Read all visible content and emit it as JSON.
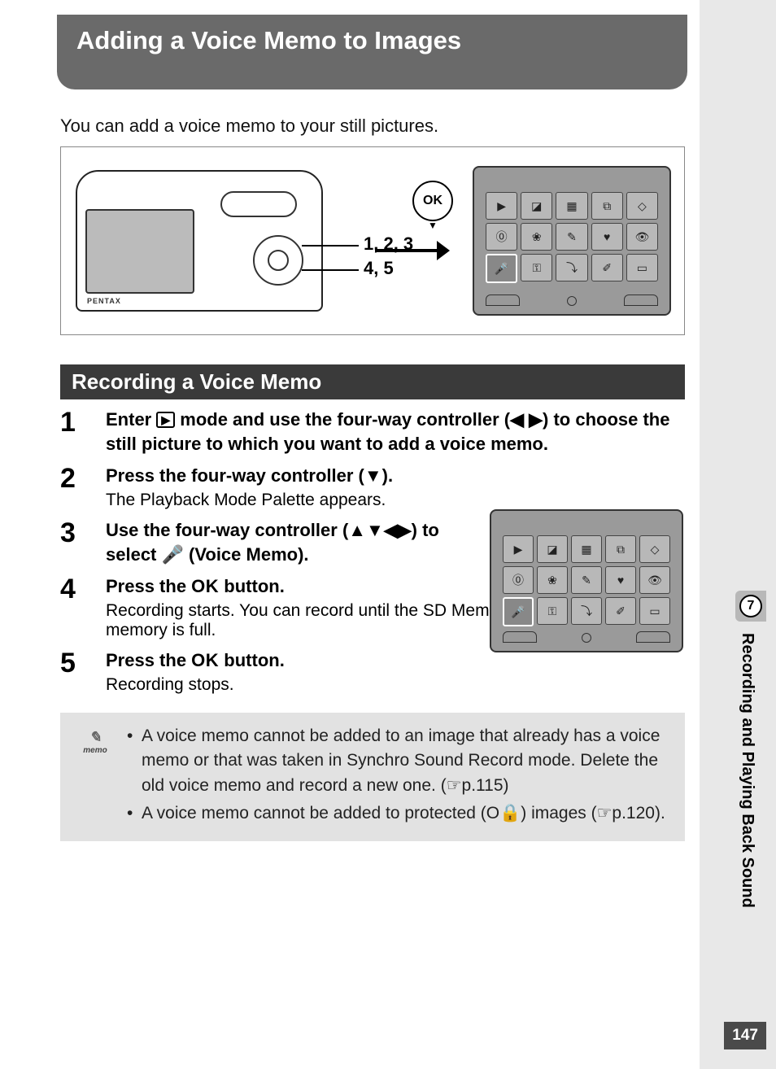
{
  "title": "Adding a Voice Memo to Images",
  "intro": "You can add a voice memo to your still pictures.",
  "diagram": {
    "camera_brand": "PENTAX",
    "leader1": "1, 2, 3",
    "leader2": "4, 5",
    "ok_label": "OK"
  },
  "section_header": "Recording a Voice Memo",
  "steps": [
    {
      "num": "1",
      "title_pre": "Enter ",
      "title_icon": "▶",
      "title_mid": " mode and use the four-way controller (◀ ▶) to choose the still picture to which you want to add a voice memo.",
      "desc": ""
    },
    {
      "num": "2",
      "title": "Press the four-way controller (▼).",
      "desc": "The Playback Mode Palette appears."
    },
    {
      "num": "3",
      "title_pre": "Use the four-way controller (▲▼◀▶) to select ",
      "title_icon": "🎤",
      "title_post": " (Voice Memo).",
      "desc": ""
    },
    {
      "num": "4",
      "title_pre": "Press the ",
      "title_ok": "OK",
      "title_post": " button.",
      "desc": "Recording starts. You can record until the SD Memory Card or built-in memory is full."
    },
    {
      "num": "5",
      "title_pre": "Press the ",
      "title_ok": "OK",
      "title_post": " button.",
      "desc": "Recording stops."
    }
  ],
  "memo": {
    "label": "memo",
    "bullets": [
      "A voice memo cannot be added to an image that already has a voice memo or that was taken in Synchro Sound Record mode. Delete the old voice memo and record a new one. (☞p.115)",
      "A voice memo cannot be added to protected (O🔒) images (☞p.120)."
    ]
  },
  "rail": {
    "chapter_num": "7",
    "chapter_title": "Recording and Playing Back Sound",
    "page_num": "147"
  },
  "palette_cells": [
    "▶",
    "◪",
    "▦",
    "⧉",
    "◇",
    "⓪",
    "❀",
    "✎",
    "♥",
    "👁",
    "🎤",
    "⚿",
    "⤵",
    "✐",
    "▭"
  ],
  "palette_highlight_index": 10
}
